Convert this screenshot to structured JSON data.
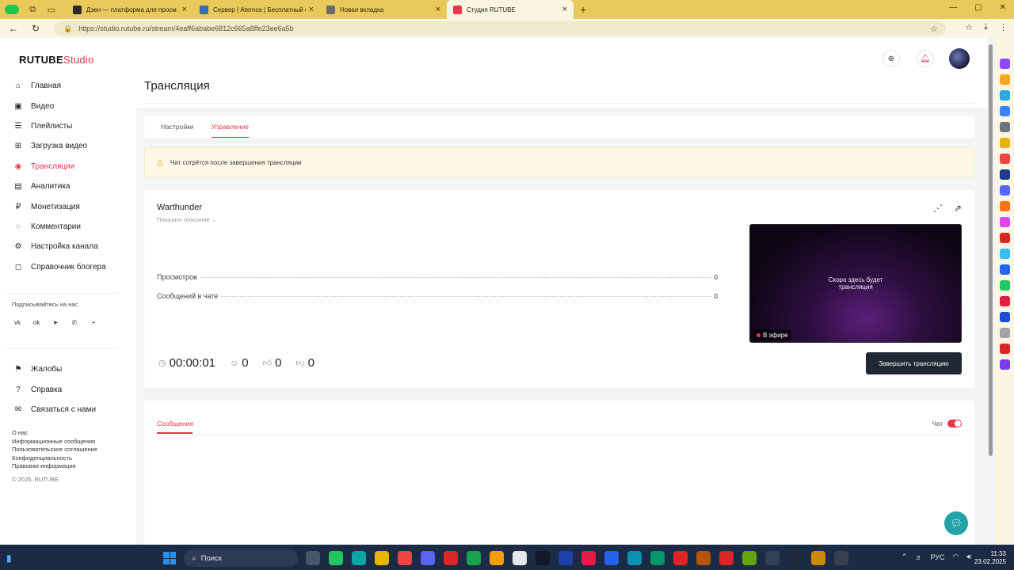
{
  "browser": {
    "tabs": [
      {
        "title": "Дзен — платформа для просм",
        "favicon_color": "#2b2b2b",
        "active": false
      },
      {
        "title": "Сервер | Aternos | Бесплатный с",
        "favicon_color": "#3a6ea5",
        "active": false
      },
      {
        "title": "Новая вкладка",
        "favicon_color": "#6b6b6b",
        "active": false
      },
      {
        "title": "Студия RUTUBE",
        "favicon_color": "#e8364b",
        "active": true
      }
    ],
    "url": "https://studio.rutube.ru/stream/4eaff6ababe6812c665a8ffe23ee6a5b"
  },
  "sidebar": {
    "logo_main": "RUTUBE",
    "logo_sub": "Studio",
    "items": [
      {
        "label": "Главная",
        "icon": "home-icon",
        "glyph": "⌂"
      },
      {
        "label": "Видео",
        "icon": "video-icon",
        "glyph": "▣"
      },
      {
        "label": "Плейлисты",
        "icon": "playlist-icon",
        "glyph": "☰"
      },
      {
        "label": "Загрузка видео",
        "icon": "upload-icon",
        "glyph": "⊞"
      },
      {
        "label": "Трансляции",
        "icon": "broadcast-icon",
        "glyph": "◉"
      },
      {
        "label": "Аналитика",
        "icon": "analytics-icon",
        "glyph": "▤"
      },
      {
        "label": "Монетизация",
        "icon": "money-icon",
        "glyph": "₽"
      },
      {
        "label": "Комментарии",
        "icon": "comments-icon",
        "glyph": "◌"
      },
      {
        "label": "Настройка канала",
        "icon": "gear-icon",
        "glyph": "⚙"
      },
      {
        "label": "Справочник блогера",
        "icon": "guide-icon",
        "glyph": "◻"
      }
    ],
    "subscribe_label": "Подписывайтесь на нас",
    "socials": [
      "vk",
      "ok",
      "tg",
      "viber",
      "+"
    ],
    "items2": [
      {
        "label": "Жалобы",
        "icon": "flag-icon",
        "glyph": "⚑"
      },
      {
        "label": "Справка",
        "icon": "help-icon",
        "glyph": "?"
      },
      {
        "label": "Связаться с нами",
        "icon": "mail-icon",
        "glyph": "✉"
      }
    ],
    "footer_links": [
      "О нас",
      "Информационные сообщения",
      "Пользовательское соглашение",
      "Конфиденциальность",
      "Правовая информация"
    ],
    "copyright": "© 2025, RUTUBE"
  },
  "header": {
    "title": "Трансляция"
  },
  "tabs": {
    "settings": "Настройки",
    "management": "Управление"
  },
  "alert": {
    "text": "Чат сотрётся после завершения трансляции"
  },
  "stream": {
    "name": "Warthunder",
    "show_description": "Показать описание",
    "views_label": "Просмотров",
    "views_value": "0",
    "messages_label": "Сообщений в чате",
    "messages_value": "0",
    "timer": "00:00:01",
    "viewers": "0",
    "likes": "0",
    "dislikes": "0",
    "preview_text_1": "Скоро здесь будет",
    "preview_text_2": "трансляция",
    "live_label": "В эфире",
    "end_button": "Завершить трансляцию"
  },
  "messages": {
    "tab_label": "Сообщения",
    "chat_label": "Чат",
    "chat_enabled": true
  },
  "taskbar": {
    "search_label": "Поиск",
    "lang": "РУС",
    "time": "11:33",
    "date": "23.02.2025"
  }
}
